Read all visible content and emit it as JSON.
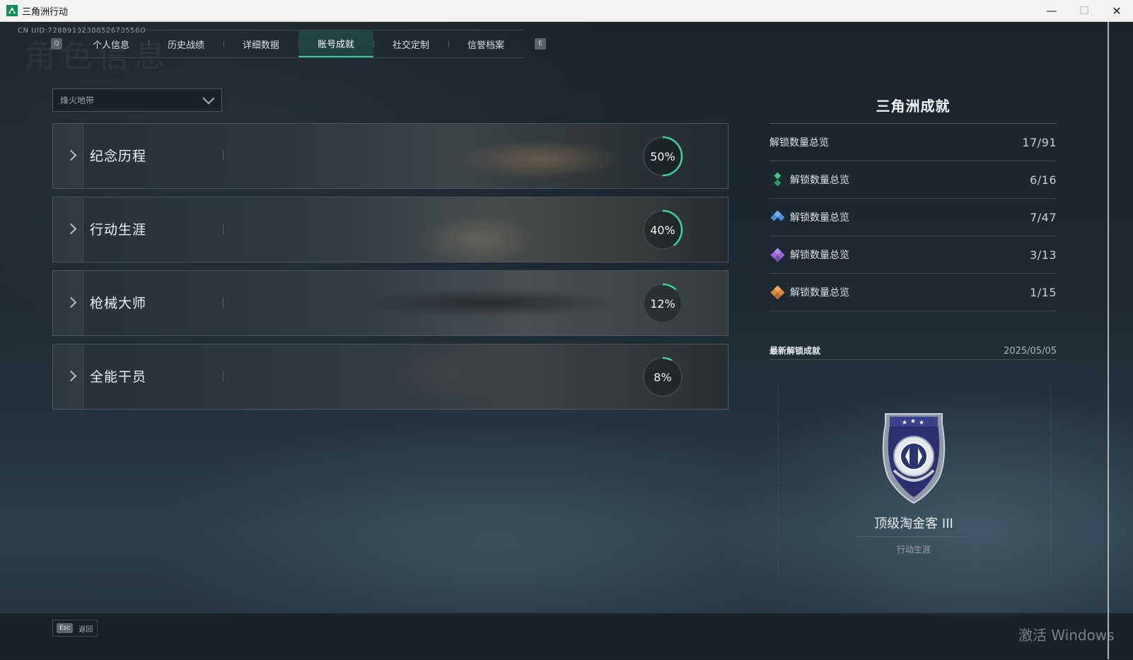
{
  "window": {
    "title": "三角洲行动",
    "min_icon": "minimize-icon",
    "max_icon": "maximize-icon",
    "close_icon": "close-icon"
  },
  "header": {
    "uid": "CN UID:7288913238852673556O",
    "watermark": "角色信息"
  },
  "tabs": {
    "left_key": "Q",
    "right_key": "E",
    "items": [
      {
        "label": "个人信息",
        "active": false
      },
      {
        "label": "历史战绩",
        "active": false
      },
      {
        "label": "详细数据",
        "active": false
      },
      {
        "label": "账号成就",
        "active": true
      },
      {
        "label": "社交定制",
        "active": false
      },
      {
        "label": "信誉档案",
        "active": false
      }
    ]
  },
  "mode_select": {
    "value": "烽火地带"
  },
  "categories": [
    {
      "title": "纪念历程",
      "percent": 50,
      "percent_label": "50%"
    },
    {
      "title": "行动生涯",
      "percent": 40,
      "percent_label": "40%"
    },
    {
      "title": "枪械大师",
      "percent": 12,
      "percent_label": "12%"
    },
    {
      "title": "全能干员",
      "percent": 8,
      "percent_label": "8%"
    }
  ],
  "panel": {
    "title": "三角洲成就",
    "total": {
      "label": "解锁数量总览",
      "value": "17/91"
    },
    "tiers": [
      {
        "label": "解锁数量总览",
        "value": "6/16",
        "color": "#3ec78f",
        "icon": "green-diamond-icon"
      },
      {
        "label": "解锁数量总览",
        "value": "7/47",
        "color": "#4a8fe0",
        "icon": "blue-diamond-icon"
      },
      {
        "label": "解锁数量总览",
        "value": "3/13",
        "color": "#9a6ad8",
        "icon": "purple-diamond-icon"
      },
      {
        "label": "解锁数量总览",
        "value": "1/15",
        "color": "#e08a3c",
        "icon": "orange-diamond-icon"
      }
    ],
    "latest": {
      "label": "最新解锁成就",
      "date": "2025/05/05"
    },
    "badge": {
      "name": "顶级淘金客 III",
      "category": "行动生涯",
      "icon": "shield-emblem-icon"
    }
  },
  "footer": {
    "esc_key": "Esc",
    "esc_label": "返回",
    "activation_watermark": "激活 Windows"
  },
  "colors": {
    "accent": "#3cc79a",
    "ring_track": "#3a444b",
    "ring_fill": "#3cd49b"
  }
}
